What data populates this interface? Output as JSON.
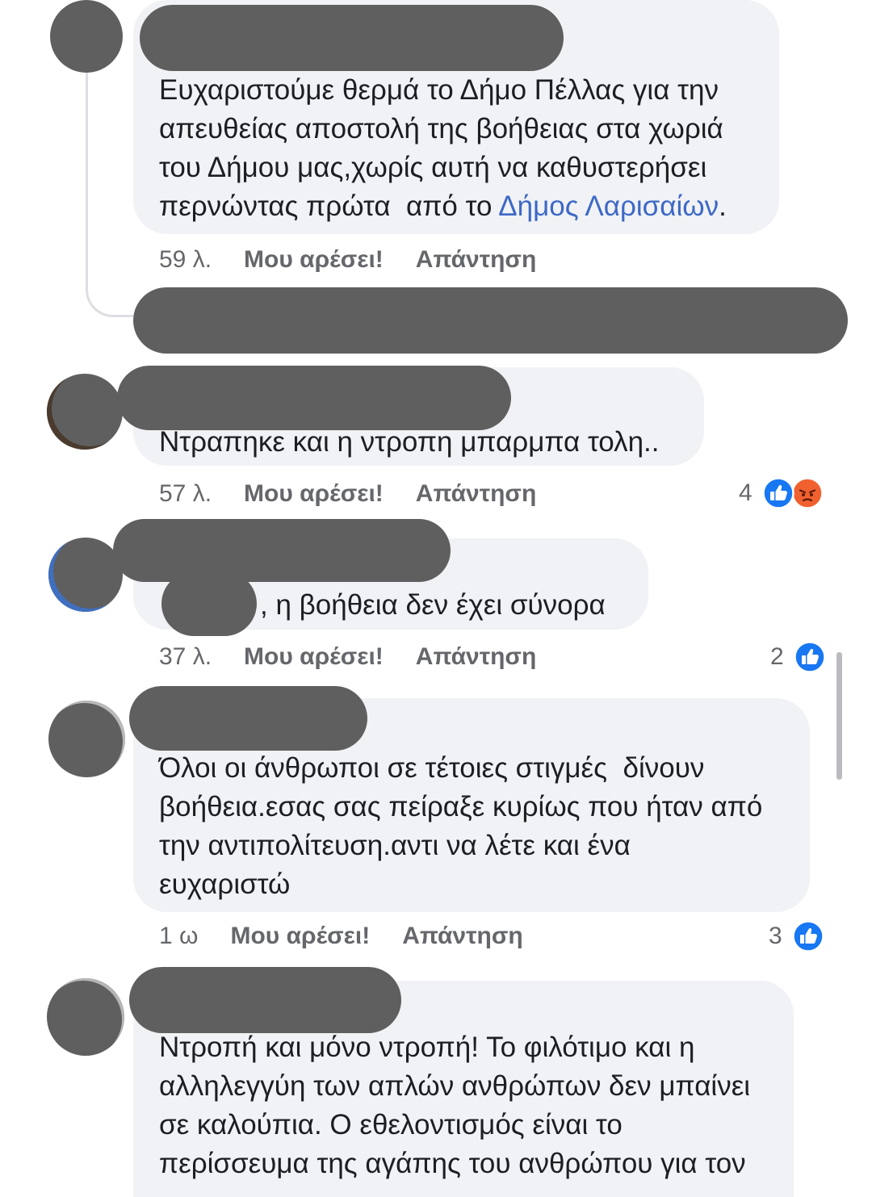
{
  "colors": {
    "bubble": "#f0f2f5",
    "redaction": "#5f5f5f",
    "text": "#1c1e21",
    "meta": "#65676b",
    "link": "#3d68c6",
    "thread_line": "#dcdee3",
    "like": "#1877f2",
    "angry": "#f0612f"
  },
  "comments": [
    {
      "lines": [
        "Ευχαριστούμε θερμά το Δήμο Πέλλας για την",
        "απευθείας αποστολή της βοήθειας στα χωριά",
        "του Δήμου μας,χωρίς αυτή να καθυστερήσει"
      ],
      "link_line": {
        "before": "περνώντας πρώτα  από το ",
        "link": "Δήμος Λαρισαίων",
        "after": "."
      },
      "time": "59 λ.",
      "like_label": "Μου αρέσει!",
      "reply_label": "Απάντηση"
    },
    {
      "lines": [
        "Ντραπηκε και η ντροπη μπαρμπα τολη.."
      ],
      "time": "57 λ.",
      "like_label": "Μου αρέσει!",
      "reply_label": "Απάντηση",
      "reactions": {
        "count": 4,
        "icons": [
          "like-icon",
          "angry-icon"
        ]
      }
    },
    {
      "lines": [
        ", η βοήθεια δεν έχει σύνορα"
      ],
      "time": "37 λ.",
      "like_label": "Μου αρέσει!",
      "reply_label": "Απάντηση",
      "reactions": {
        "count": 2,
        "icons": [
          "like-icon"
        ]
      }
    },
    {
      "lines": [
        "Όλοι οι άνθρωποι σε τέτοιες στιγμές  δίνουν",
        "βοήθεια.εσας σας πείραξε κυρίως που ήταν από",
        "την αντιπολίτευση.αντι να λέτε και ένα",
        "ευχαριστώ"
      ],
      "time": "1 ω",
      "like_label": "Μου αρέσει!",
      "reply_label": "Απάντηση",
      "reactions": {
        "count": 3,
        "icons": [
          "like-icon"
        ]
      }
    },
    {
      "lines": [
        "Ντροπή και μόνο ντροπή! Το φιλότιμο και η",
        "αλληλεγγύη των απλών ανθρώπων δεν μπαίνει",
        "σε καλούπια. Ο εθελοντισμός είναι το",
        "περίσσευμα της αγάπης του ανθρώπου για τον"
      ]
    }
  ]
}
